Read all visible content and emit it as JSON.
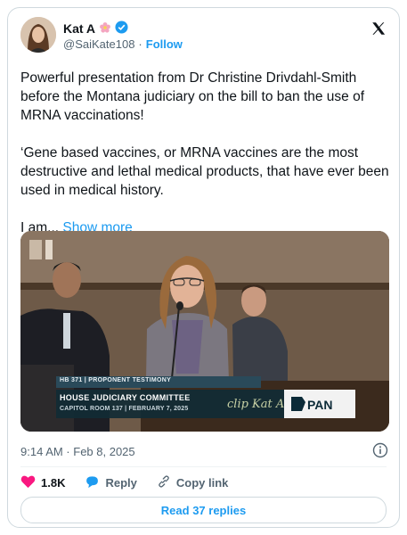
{
  "author": {
    "name": "Kat A",
    "handle": "@SaiKate108",
    "separator": "·",
    "follow_label": "Follow"
  },
  "tweet": {
    "paragraph1": "Powerful presentation from Dr Christine Drivdahl-Smith before the Montana judiciary on the bill to ban the use of MRNA vaccinations!",
    "paragraph2": "‘Gene based vaccines, or MRNA  vaccines are the most destructive and lethal medical products, that have ever been used in medical history.",
    "paragraph3": "I  am...",
    "show_more": "Show more"
  },
  "media": {
    "banner_small": "HB 371 | PROPONENT TESTIMONY",
    "banner_title": "HOUSE JUDICIARY COMMITTEE",
    "banner_sub": "CAPITOL ROOM 137 | FEBRUARY 7, 2025",
    "watermark": "clip Kat A",
    "network": "PAN"
  },
  "meta": {
    "timestamp": "9:14 AM · Feb 8, 2025"
  },
  "actions": {
    "likes": "1.8K",
    "reply_label": "Reply",
    "copy_link_label": "Copy link",
    "read_replies_label": "Read 37 replies"
  },
  "colors": {
    "accent": "#1d9bf0",
    "like": "#f91880",
    "verified": "#1d9bf0"
  },
  "icons": [
    "flower-emoji-icon",
    "verified-badge-icon",
    "x-logo-icon",
    "info-icon",
    "heart-icon",
    "reply-bubble-icon",
    "link-icon"
  ]
}
